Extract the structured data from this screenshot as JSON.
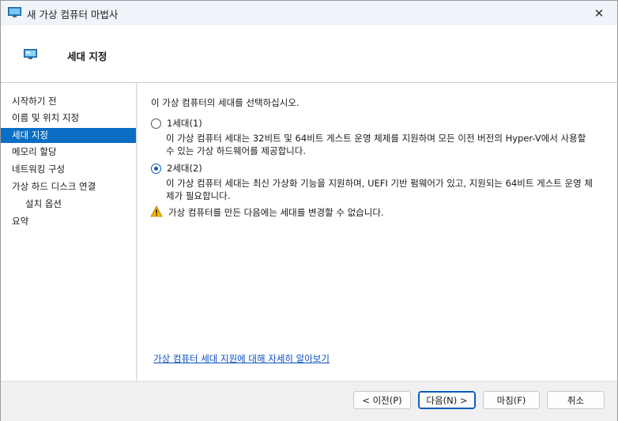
{
  "window": {
    "title": "새 가상 컴퓨터 마법사",
    "close_glyph": "✕",
    "app_icon": "monitor-icon"
  },
  "header": {
    "title": "세대 지정",
    "icon": "monitor-icon"
  },
  "sidebar": {
    "items": [
      {
        "label": "시작하기 전",
        "active": false,
        "indent": false
      },
      {
        "label": "이름 및 위치 지정",
        "active": false,
        "indent": false
      },
      {
        "label": "세대 지정",
        "active": true,
        "indent": false
      },
      {
        "label": "메모리 할당",
        "active": false,
        "indent": false
      },
      {
        "label": "네트워킹 구성",
        "active": false,
        "indent": false
      },
      {
        "label": "가상 하드 디스크 연결",
        "active": false,
        "indent": false
      },
      {
        "label": "설치 옵션",
        "active": false,
        "indent": true
      },
      {
        "label": "요약",
        "active": false,
        "indent": false
      }
    ]
  },
  "main": {
    "prompt": "이 가상 컴퓨터의 세대를 선택하십시오.",
    "gen1": {
      "label": "1세대(1)",
      "selected": false,
      "desc": "이 가상 컴퓨터 세대는 32비트 및 64비트 게스트 운영 체제를 지원하며 모든 이전 버전의 Hyper-V에서 사용할 수 있는 가상 하드웨어를 제공합니다."
    },
    "gen2": {
      "label": "2세대(2)",
      "selected": true,
      "desc": "이 가상 컴퓨터 세대는 최신 가상화 기능을 지원하며, UEFI 기반 펌웨어가 있고, 지원되는 64비트 게스트 운영 체제가 필요합니다."
    },
    "warning": "가상 컴퓨터를 만든 다음에는 세대를 변경할 수 없습니다.",
    "learn_more": "가상 컴퓨터 세대 지원에 대해 자세히 알아보기"
  },
  "footer": {
    "prev": "< 이전(P)",
    "next": "다음(N) >",
    "finish": "마침(F)",
    "cancel": "취소"
  },
  "colors": {
    "accent": "#0b6ec5",
    "link": "#0b4fc2",
    "warning": "#e8a200"
  }
}
